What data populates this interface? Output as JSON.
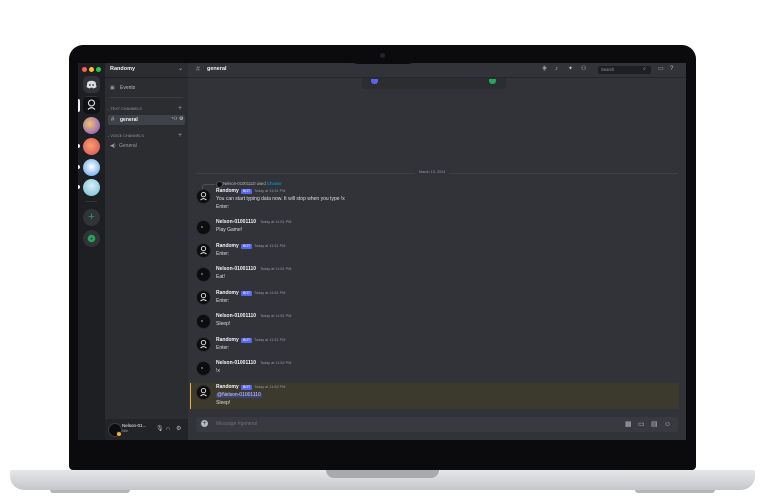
{
  "server": {
    "name": "Randomy",
    "events_label": "Events",
    "text_channels_label": "TEXT CHANNELS",
    "voice_channels_label": "VOICE CHANNELS",
    "text_channel": "general",
    "voice_channel": "General"
  },
  "header": {
    "channel": "general",
    "search_placeholder": "Search"
  },
  "chat": {
    "date_divider": "March 13, 2024",
    "reply_ref": {
      "user": "Nelson-01001110",
      "action": "used",
      "command": "/choose"
    },
    "messages": [
      {
        "author": "Randomy",
        "bot_badge": "BOT",
        "time": "Today at 11:51 PM",
        "lines": [
          "You can start typing data now. It will stop when you type !x",
          "Enter:"
        ]
      },
      {
        "author": "Nelson-01001110",
        "time": "Today at 11:51 PM",
        "lines": [
          "Play Game!"
        ]
      },
      {
        "author": "Randomy",
        "bot_badge": "BOT",
        "time": "Today at 11:51 PM",
        "lines": [
          "Enter:"
        ]
      },
      {
        "author": "Nelson-01001110",
        "time": "Today at 11:51 PM",
        "lines": [
          "Eat!"
        ]
      },
      {
        "author": "Randomy",
        "bot_badge": "BOT",
        "time": "Today at 11:51 PM",
        "lines": [
          "Enter:"
        ]
      },
      {
        "author": "Nelson-01001110",
        "time": "Today at 11:51 PM",
        "lines": [
          "Sleep!"
        ]
      },
      {
        "author": "Randomy",
        "bot_badge": "BOT",
        "time": "Today at 11:51 PM",
        "lines": [
          "Enter:"
        ]
      },
      {
        "author": "Nelson-01001110",
        "time": "Today at 11:52 PM",
        "lines": [
          "!x"
        ]
      },
      {
        "author": "Randomy",
        "bot_badge": "BOT",
        "time": "Today at 11:52 PM",
        "mention": "@Nelson-01001110",
        "lines": [
          "Sleep!"
        ]
      }
    ]
  },
  "composer": {
    "placeholder": "Message #general"
  },
  "user": {
    "name": "Nelson-01...",
    "status": "Idle"
  },
  "colors": {
    "accent": "#5865f2",
    "mention_bg": "#3b3a2c",
    "online": "#23a55a",
    "link": "#00a8fc"
  }
}
